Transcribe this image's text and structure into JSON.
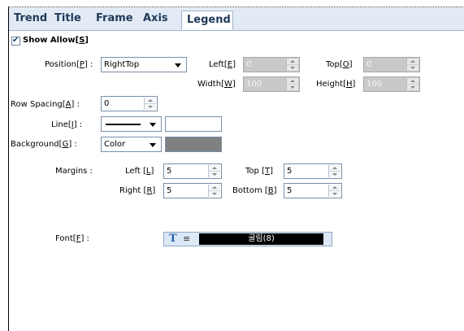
{
  "tabs": [
    {
      "label": "Trend"
    },
    {
      "label": "Title"
    },
    {
      "label": "Frame"
    },
    {
      "label": "Axis"
    },
    {
      "label": "Legend"
    }
  ],
  "active_tab": "Legend",
  "show_allow": {
    "label": "Show Allow",
    "mnemonic": "S",
    "checked": true
  },
  "position": {
    "label": "Position",
    "mnemonic": "P",
    "value": "RightTop"
  },
  "left": {
    "label": "Left",
    "mnemonic": "E",
    "value": "0"
  },
  "top": {
    "label": "Top",
    "mnemonic": "O",
    "value": "0"
  },
  "width": {
    "label": "Width",
    "mnemonic": "W",
    "value": "100"
  },
  "height": {
    "label": "Height",
    "mnemonic": "H",
    "value": "100"
  },
  "row_spacing": {
    "label": "Row Spacing",
    "mnemonic": "A",
    "value": "0"
  },
  "line": {
    "label": "Line",
    "mnemonic": "I",
    "swatch_color": "#ffffff"
  },
  "background": {
    "label": "Background",
    "mnemonic": "G",
    "value": "Color",
    "swatch_color": "#808080"
  },
  "margins": {
    "label": "Margins :",
    "left": {
      "label": "Left",
      "mnemonic": "L",
      "value": "5"
    },
    "top": {
      "label": "Top",
      "mnemonic": "T",
      "value": "5"
    },
    "right": {
      "label": "Right",
      "mnemonic": "R",
      "value": "5"
    },
    "bottom": {
      "label": "Bottom",
      "mnemonic": "B",
      "value": "5"
    }
  },
  "font": {
    "label": "Font",
    "mnemonic": "F",
    "value": "굴림(8)"
  },
  "colors": {
    "tab_bar": "#e2ebf5",
    "tab_text": "#1f3a5a",
    "font_preview_bg": "#000000",
    "disabled_field": "#c9c9c9"
  }
}
